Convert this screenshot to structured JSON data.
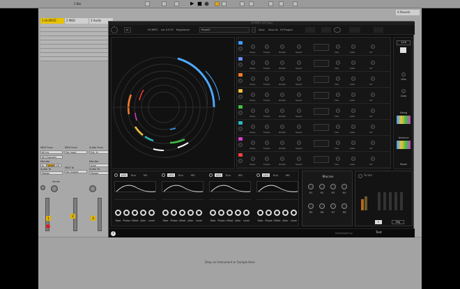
{
  "daw": {
    "transport": {
      "tempo": "1 Bar"
    },
    "tracks": [
      {
        "name": "1 Hi-SPICE",
        "color": "#e8c200",
        "number": "1"
      },
      {
        "name": "2 MIDI",
        "color": "#c8c8c8",
        "number": "2"
      },
      {
        "name": "3 Audio",
        "color": "#c8c8c8",
        "number": "3"
      }
    ],
    "return_track": {
      "name": "A Reverb"
    },
    "io": {
      "midi_from": "MIDI From",
      "midi_from_value": "All Ins",
      "all_channels": "All Channels",
      "monitor": "Monitor",
      "monitor_in": "In",
      "monitor_auto": "Auto",
      "monitor_off": "Off",
      "audio_to": "Audio To",
      "audio_to_value": "Master",
      "midi_to": "MIDI To",
      "midi_to_value": "No Output",
      "midi_from_2": "No Input",
      "audio_from": "Audio From",
      "audio_from_value": "Ext. In",
      "sends": "Sends"
    },
    "drop_hint": "Drop an Instrument or Sample Here"
  },
  "plugin": {
    "title": "HY-RPE2 VST3/AU",
    "toolbar": {
      "product": "HY-RPE2",
      "version": "ver 0.9.97",
      "registered": "Registered",
      "preset": "Preset?",
      "save": "Save",
      "save_as": "Save As",
      "plugins": "HY-Plugins"
    },
    "sequencer": {
      "lanes": [
        {
          "chip_color": "#3aa0ff",
          "ring_color": "#7fc4ff"
        },
        {
          "chip_color": "#6a8cff",
          "ring_color": "#6a8cff"
        },
        {
          "chip_color": "#ff7a2a",
          "ring_color": "#ff7a2a"
        },
        {
          "chip_color": "#f0c040",
          "ring_color": "#f0c040"
        },
        {
          "chip_color": "#3ec040",
          "ring_color": "#3ec040"
        },
        {
          "chip_color": "#2ab8c0",
          "ring_color": "#2ab8c0"
        },
        {
          "chip_color": "#d040d0",
          "ring_color": "#d040d0"
        },
        {
          "chip_color": "#ff4040",
          "ring_color": "#ff4040"
        }
      ],
      "lane_labels": [
        "Steps",
        "Pulses",
        "Rotate",
        "Speed",
        "Velo",
        "Gate",
        "CH"
      ]
    },
    "sidepanel": {
      "rate": "1/16",
      "velo": "Velo",
      "gate": "Gate",
      "swing": "Swing",
      "variance": "Variance",
      "reset": "Reset"
    },
    "lfos": [
      {
        "tab": "LFO",
        "label2": "Env",
        "label3": "M1"
      },
      {
        "tab": "LFO",
        "label2": "Env",
        "label3": "M2"
      },
      {
        "tab": "LFO",
        "label2": "Env",
        "label3": "M3"
      },
      {
        "tab": "LFO",
        "label2": "Env",
        "label3": "M4"
      }
    ],
    "lfo_knobs": [
      "Rate",
      "Phase",
      "Offset",
      "Jitter",
      "Level"
    ],
    "macros": {
      "title": "Macros",
      "labels": [
        "M1",
        "M2",
        "M3",
        "M4",
        "M5",
        "M6",
        "M7",
        "M8"
      ]
    },
    "scale": {
      "title": "Scale",
      "root": "C",
      "mode": "Maj"
    },
    "status": {
      "credit": "Developed by",
      "test": "Test"
    }
  },
  "colors": {
    "accent_yellow": "#e8c200",
    "ring_main": "#5ab0ff"
  }
}
